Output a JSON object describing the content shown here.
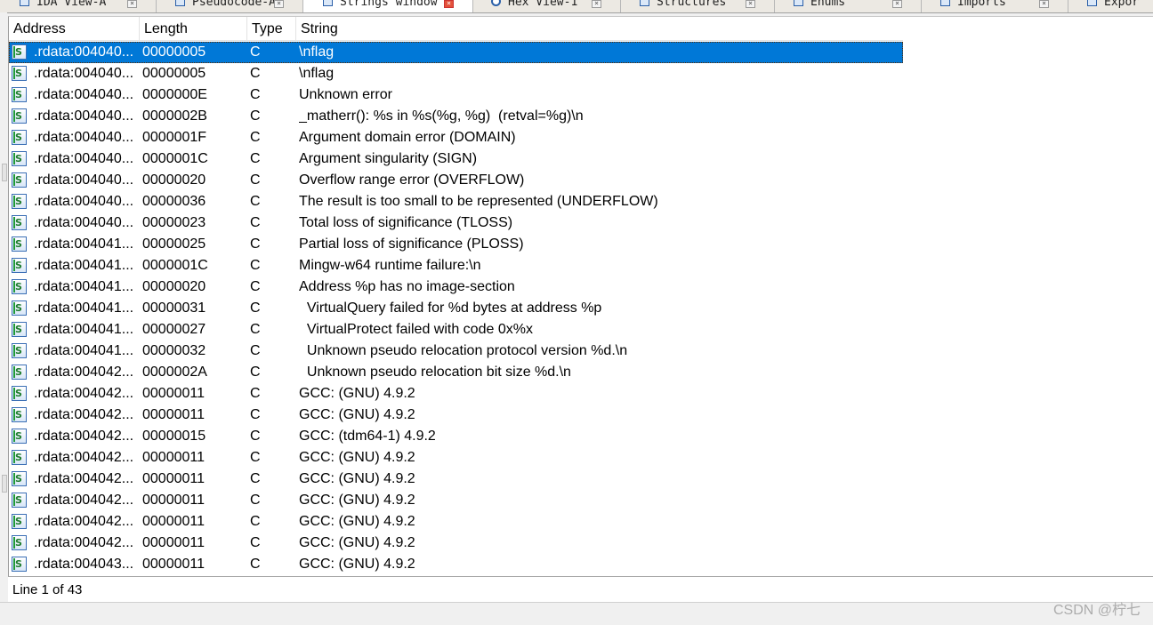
{
  "tabs": [
    {
      "label": "IDA View-A",
      "icon": "ida-view-icon"
    },
    {
      "label": "Pseudocode-A",
      "icon": "pseudocode-icon"
    },
    {
      "label": "Strings window",
      "icon": "strings-icon"
    },
    {
      "label": "Hex View-1",
      "icon": "hex-icon"
    },
    {
      "label": "Structures",
      "icon": "structures-icon"
    },
    {
      "label": "Enums",
      "icon": "enums-icon"
    },
    {
      "label": "Imports",
      "icon": "imports-icon"
    },
    {
      "label": "Expor",
      "icon": "exports-icon"
    }
  ],
  "active_tab": "Strings window",
  "columns": [
    "Address",
    "Length",
    "Type",
    "String"
  ],
  "rows": [
    {
      "address": ".rdata:004040...",
      "length": "00000005",
      "type": "C",
      "string": "\\nflag"
    },
    {
      "address": ".rdata:004040...",
      "length": "00000005",
      "type": "C",
      "string": "\\nflag"
    },
    {
      "address": ".rdata:004040...",
      "length": "0000000E",
      "type": "C",
      "string": "Unknown error"
    },
    {
      "address": ".rdata:004040...",
      "length": "0000002B",
      "type": "C",
      "string": "_matherr(): %s in %s(%g, %g)  (retval=%g)\\n"
    },
    {
      "address": ".rdata:004040...",
      "length": "0000001F",
      "type": "C",
      "string": "Argument domain error (DOMAIN)"
    },
    {
      "address": ".rdata:004040...",
      "length": "0000001C",
      "type": "C",
      "string": "Argument singularity (SIGN)"
    },
    {
      "address": ".rdata:004040...",
      "length": "00000020",
      "type": "C",
      "string": "Overflow range error (OVERFLOW)"
    },
    {
      "address": ".rdata:004040...",
      "length": "00000036",
      "type": "C",
      "string": "The result is too small to be represented (UNDERFLOW)"
    },
    {
      "address": ".rdata:004040...",
      "length": "00000023",
      "type": "C",
      "string": "Total loss of significance (TLOSS)"
    },
    {
      "address": ".rdata:004041...",
      "length": "00000025",
      "type": "C",
      "string": "Partial loss of significance (PLOSS)"
    },
    {
      "address": ".rdata:004041...",
      "length": "0000001C",
      "type": "C",
      "string": "Mingw-w64 runtime failure:\\n"
    },
    {
      "address": ".rdata:004041...",
      "length": "00000020",
      "type": "C",
      "string": "Address %p has no image-section"
    },
    {
      "address": ".rdata:004041...",
      "length": "00000031",
      "type": "C",
      "string": "  VirtualQuery failed for %d bytes at address %p"
    },
    {
      "address": ".rdata:004041...",
      "length": "00000027",
      "type": "C",
      "string": "  VirtualProtect failed with code 0x%x"
    },
    {
      "address": ".rdata:004041...",
      "length": "00000032",
      "type": "C",
      "string": "  Unknown pseudo relocation protocol version %d.\\n"
    },
    {
      "address": ".rdata:004042...",
      "length": "0000002A",
      "type": "C",
      "string": "  Unknown pseudo relocation bit size %d.\\n"
    },
    {
      "address": ".rdata:004042...",
      "length": "00000011",
      "type": "C",
      "string": "GCC: (GNU) 4.9.2"
    },
    {
      "address": ".rdata:004042...",
      "length": "00000011",
      "type": "C",
      "string": "GCC: (GNU) 4.9.2"
    },
    {
      "address": ".rdata:004042...",
      "length": "00000015",
      "type": "C",
      "string": "GCC: (tdm64-1) 4.9.2"
    },
    {
      "address": ".rdata:004042...",
      "length": "00000011",
      "type": "C",
      "string": "GCC: (GNU) 4.9.2"
    },
    {
      "address": ".rdata:004042...",
      "length": "00000011",
      "type": "C",
      "string": "GCC: (GNU) 4.9.2"
    },
    {
      "address": ".rdata:004042...",
      "length": "00000011",
      "type": "C",
      "string": "GCC: (GNU) 4.9.2"
    },
    {
      "address": ".rdata:004042...",
      "length": "00000011",
      "type": "C",
      "string": "GCC: (GNU) 4.9.2"
    },
    {
      "address": ".rdata:004042...",
      "length": "00000011",
      "type": "C",
      "string": "GCC: (GNU) 4.9.2"
    },
    {
      "address": ".rdata:004043...",
      "length": "00000011",
      "type": "C",
      "string": "GCC: (GNU) 4.9.2"
    }
  ],
  "selected_row": 0,
  "status": {
    "text": "Line 1 of 43"
  },
  "watermark": "CSDN @柠七",
  "colors": {
    "selection": "#0078d7",
    "window": "#ffffff",
    "chrome": "#f0f0f0"
  }
}
